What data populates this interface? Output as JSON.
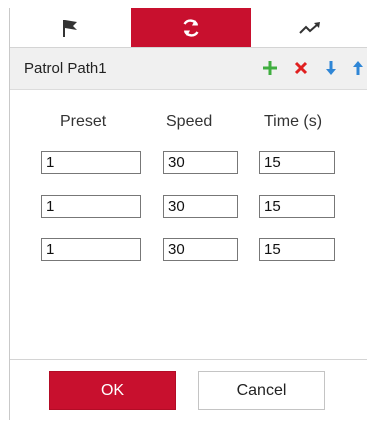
{
  "tabs": [
    {
      "icon": "flag-icon",
      "active": false
    },
    {
      "icon": "refresh-cycle-icon",
      "active": true
    },
    {
      "icon": "trend-arrow-icon",
      "active": false
    }
  ],
  "path": {
    "name": "Patrol Path1",
    "actions": [
      {
        "icon": "add-icon",
        "color": "#3fae3f"
      },
      {
        "icon": "delete-icon",
        "color": "#e02020"
      },
      {
        "icon": "arrow-down-icon",
        "color": "#2f86d6"
      },
      {
        "icon": "arrow-up-icon",
        "color": "#2f86d6"
      }
    ]
  },
  "table": {
    "headers": {
      "preset": "Preset",
      "speed": "Speed",
      "time": "Time (s)"
    },
    "rows": [
      {
        "preset": "1",
        "speed": "30",
        "time": "15"
      },
      {
        "preset": "1",
        "speed": "30",
        "time": "15"
      },
      {
        "preset": "1",
        "speed": "30",
        "time": "15"
      }
    ]
  },
  "footer": {
    "ok_label": "OK",
    "cancel_label": "Cancel"
  },
  "colors": {
    "accent": "#c8102e",
    "add": "#3fae3f",
    "delete": "#e02020",
    "move": "#2f86d6"
  }
}
